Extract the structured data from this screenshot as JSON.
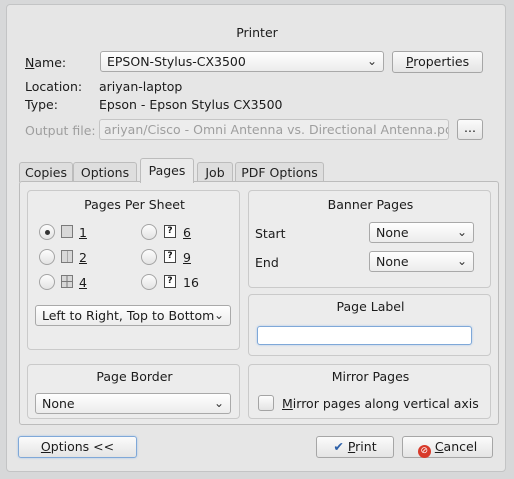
{
  "window": {
    "title": "Printer"
  },
  "printer": {
    "name_label": "Name:",
    "name_value": "EPSON-Stylus-CX3500",
    "properties_label": "Properties",
    "location_label": "Location:",
    "location_value": "ariyan-laptop",
    "type_label": "Type:",
    "type_value": "Epson - Epson Stylus CX3500",
    "output_label": "Output file:",
    "output_value": "ariyan/Cisco - Omni Antenna vs. Directional Antenna.pdf",
    "browse_label": "..."
  },
  "tabs": [
    {
      "label": "Copies"
    },
    {
      "label": "Options"
    },
    {
      "label": "Pages"
    },
    {
      "label": "Job"
    },
    {
      "label": "PDF Options"
    }
  ],
  "pages_per_sheet": {
    "title": "Pages Per Sheet",
    "options": [
      "1",
      "2",
      "4",
      "6",
      "9",
      "16"
    ],
    "selected": "1",
    "order_value": "Left to Right, Top to Bottom"
  },
  "banner_pages": {
    "title": "Banner Pages",
    "start_label": "Start",
    "start_value": "None",
    "end_label": "End",
    "end_value": "None"
  },
  "page_label": {
    "title": "Page Label",
    "value": ""
  },
  "page_border": {
    "title": "Page Border",
    "value": "None"
  },
  "mirror_pages": {
    "title": "Mirror Pages",
    "checkbox_label": "Mirror pages along vertical axis",
    "checked": false
  },
  "footer": {
    "options_label": "Options <<",
    "print_label": "Print",
    "cancel_label": "Cancel"
  },
  "colors": {
    "focus": "#7fa8d8",
    "cancel_icon": "#d83a2a",
    "print_icon": "#2b5fa8"
  }
}
